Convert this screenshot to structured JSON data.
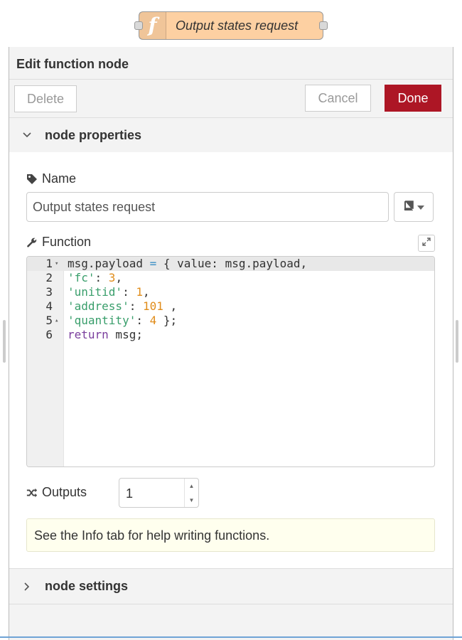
{
  "node": {
    "icon_glyph": "f",
    "label": "Output states request"
  },
  "tray": {
    "title": "Edit function node",
    "delete_label": "Delete",
    "cancel_label": "Cancel",
    "done_label": "Done"
  },
  "properties": {
    "title": "node properties",
    "name_label": "Name",
    "name_value": "Output states request",
    "function_label": "Function",
    "code_lines": [
      {
        "n": "1",
        "fold": "▾"
      },
      {
        "n": "2",
        "fold": ""
      },
      {
        "n": "3",
        "fold": ""
      },
      {
        "n": "4",
        "fold": ""
      },
      {
        "n": "5",
        "fold": "▴"
      },
      {
        "n": "6",
        "fold": ""
      }
    ],
    "code_text": [
      "msg.payload = { value: msg.payload,",
      "'fc': 3,",
      "'unitid': 1,",
      "'address': 101 ,",
      "'quantity': 4 };",
      "return msg;"
    ],
    "outputs_label": "Outputs",
    "outputs_value": "1",
    "tip": "See the Info tab for help writing functions."
  },
  "settings": {
    "title": "node settings"
  },
  "colors": {
    "node_fill": "#fdd0a2",
    "done_button": "#ad1625",
    "tip_background": "#ffffee"
  },
  "icons": [
    "function-icon",
    "tag-icon",
    "book-icon",
    "caret-down-icon",
    "wrench-icon",
    "expand-icon",
    "shuffle-icon",
    "chevron-down-icon",
    "chevron-right-icon"
  ]
}
